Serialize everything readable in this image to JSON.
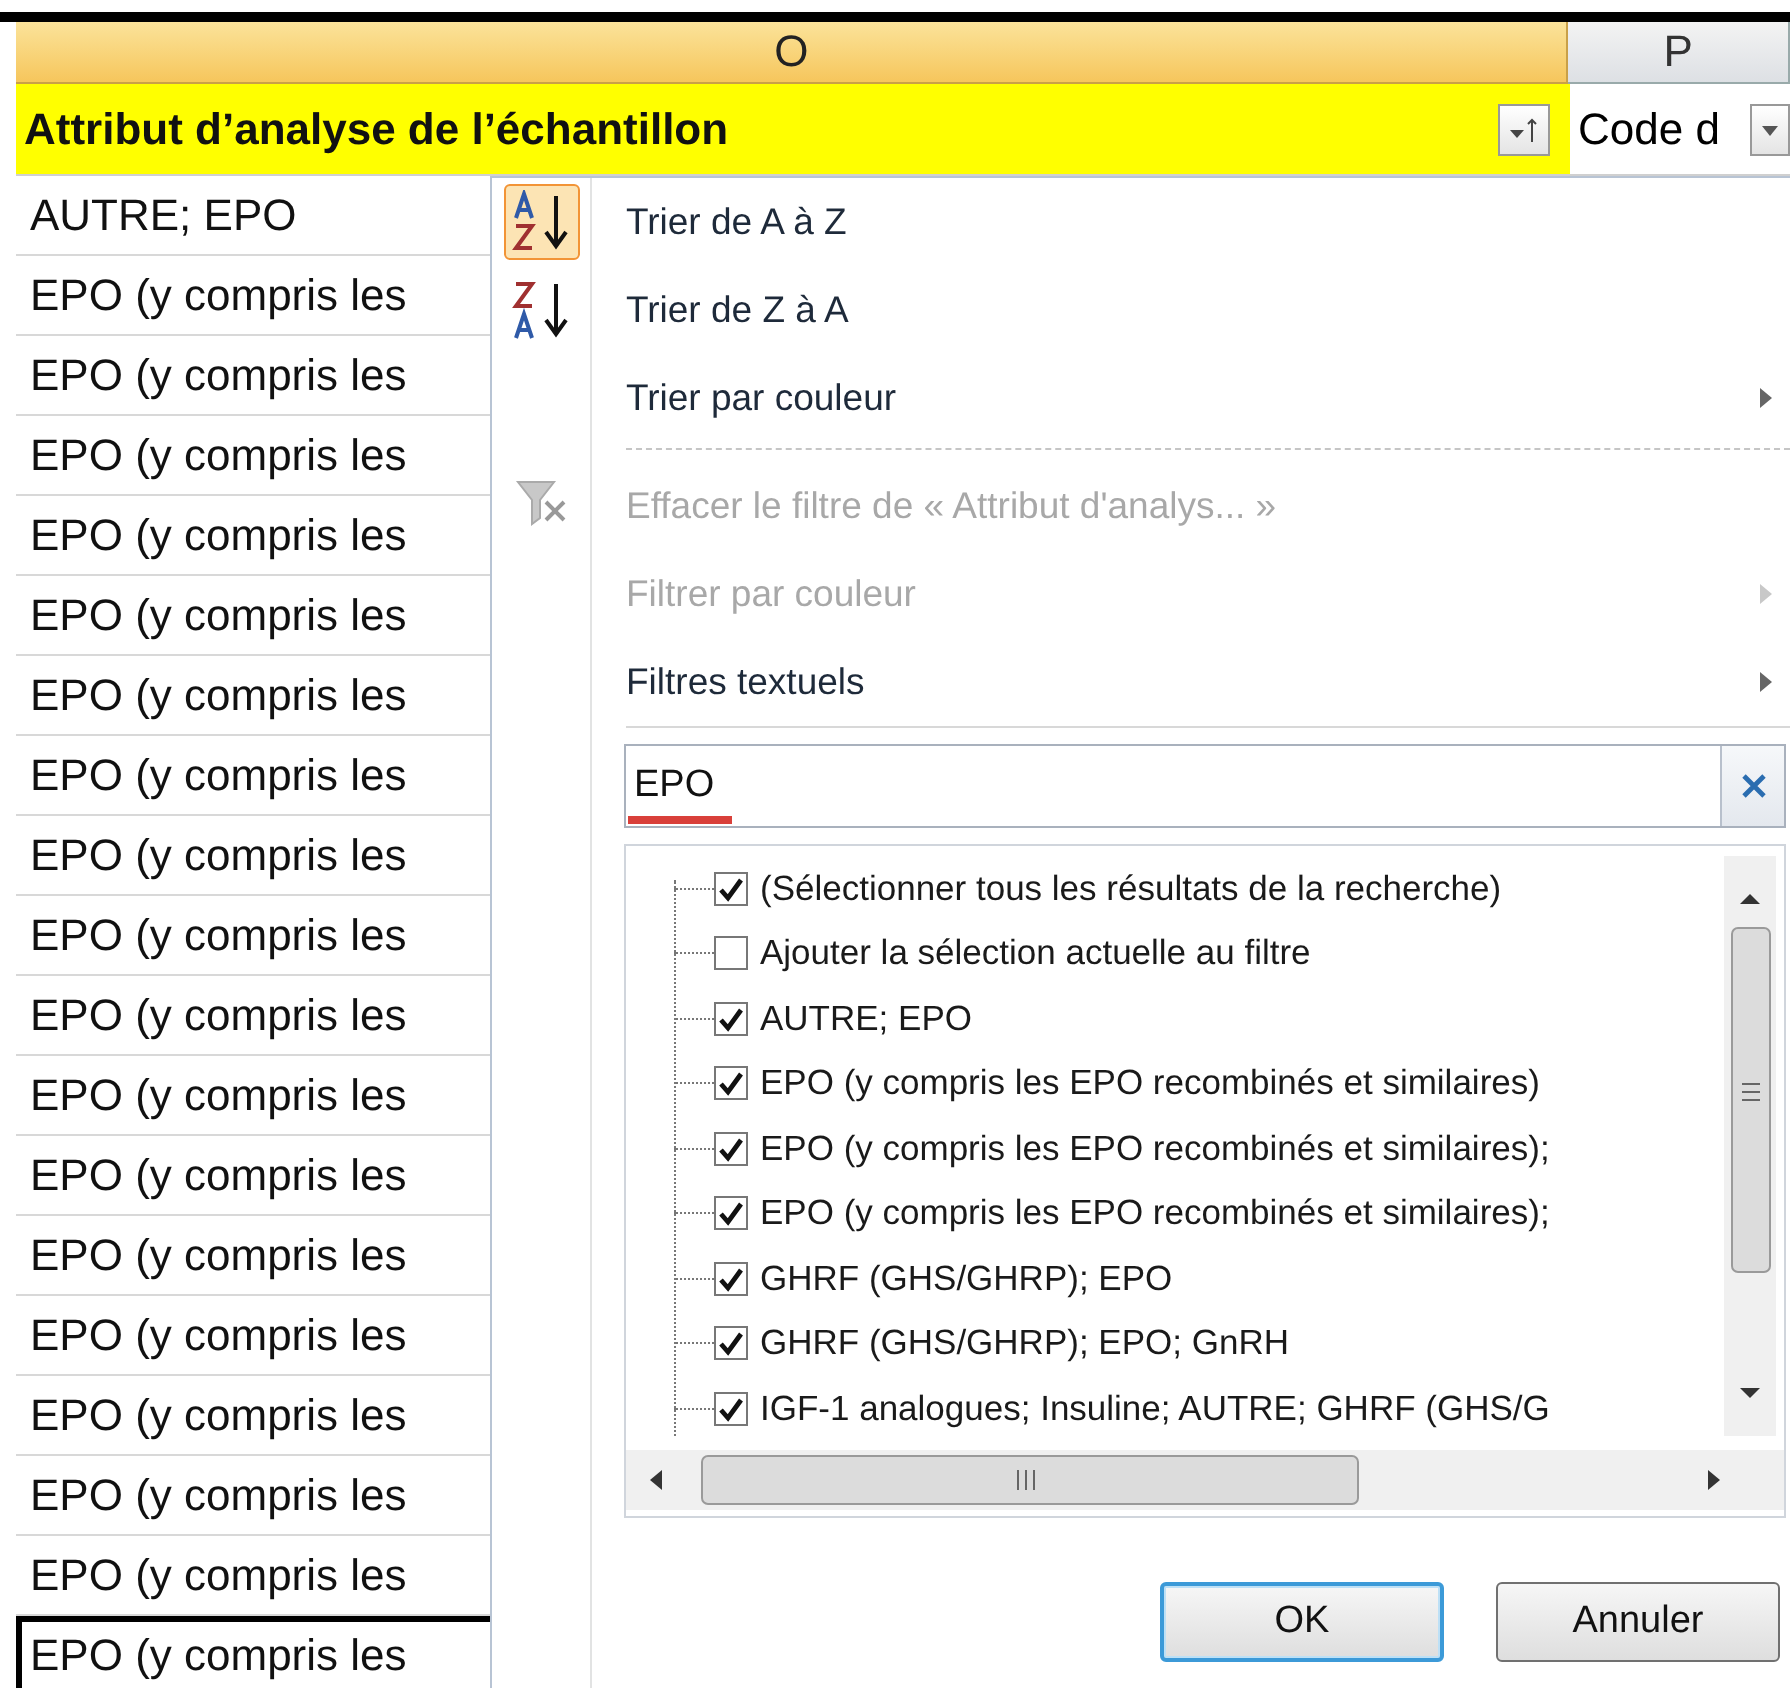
{
  "sheet": {
    "columns": [
      {
        "label": "O",
        "selected": true
      },
      {
        "label": "P",
        "selected": false
      }
    ],
    "header": {
      "title": "Attribut d’analyse de l’échantillon",
      "filter_active": true,
      "next": "Code d"
    },
    "rows": [
      {
        "text": "AUTRE; EPO",
        "selected": false
      },
      {
        "text": "EPO (y compris les",
        "selected": false
      },
      {
        "text": "EPO (y compris les",
        "selected": false
      },
      {
        "text": "EPO (y compris les",
        "selected": false
      },
      {
        "text": "EPO (y compris les",
        "selected": false
      },
      {
        "text": "EPO (y compris les",
        "selected": false
      },
      {
        "text": "EPO (y compris les",
        "selected": false
      },
      {
        "text": "EPO (y compris les",
        "selected": false
      },
      {
        "text": "EPO (y compris les",
        "selected": false
      },
      {
        "text": "EPO (y compris les",
        "selected": false
      },
      {
        "text": "EPO (y compris les",
        "selected": false
      },
      {
        "text": "EPO (y compris les",
        "selected": false
      },
      {
        "text": "EPO (y compris les",
        "selected": false
      },
      {
        "text": "EPO (y compris les",
        "selected": false
      },
      {
        "text": "EPO (y compris les",
        "selected": false
      },
      {
        "text": "EPO (y compris les",
        "selected": false
      },
      {
        "text": "EPO (y compris les",
        "selected": false
      },
      {
        "text": "EPO (y compris les",
        "selected": false
      },
      {
        "text": "EPO (y compris les",
        "selected": true
      }
    ]
  },
  "menu": {
    "items": [
      {
        "kind": "sort-ascending",
        "label": "Trier de A à Z",
        "disabled": false,
        "submenu": false,
        "selected": true
      },
      {
        "kind": "sort-descending",
        "label": "Trier de Z à A",
        "disabled": false,
        "submenu": false,
        "selected": false
      },
      {
        "kind": "plain",
        "label": "Trier par couleur",
        "disabled": false,
        "submenu": true,
        "selected": false
      },
      {
        "kind": "separator"
      },
      {
        "kind": "clear-filter",
        "label": "Effacer le filtre de « Attribut d'analys... »",
        "disabled": true,
        "submenu": false,
        "selected": false
      },
      {
        "kind": "plain",
        "label": "Filtrer par couleur",
        "disabled": true,
        "submenu": true,
        "selected": false
      },
      {
        "kind": "plain",
        "label": "Filtres textuels",
        "disabled": false,
        "submenu": true,
        "selected": false
      },
      {
        "kind": "separator"
      }
    ],
    "search": {
      "value": "EPO"
    },
    "values": [
      {
        "label": "(Sélectionner tous les résultats de la recherche)",
        "checked": true
      },
      {
        "label": "Ajouter la sélection actuelle au filtre",
        "checked": false
      },
      {
        "label": "AUTRE; EPO",
        "checked": true
      },
      {
        "label": "EPO (y compris les EPO recombinés et similaires)",
        "checked": true
      },
      {
        "label": "EPO (y compris les EPO recombinés et similaires);",
        "checked": true
      },
      {
        "label": "EPO (y compris les EPO recombinés et similaires);",
        "checked": true
      },
      {
        "label": "GHRF (GHS/GHRP); EPO",
        "checked": true
      },
      {
        "label": "GHRF (GHS/GHRP); EPO; GnRH",
        "checked": true
      },
      {
        "label": "IGF-1 analogues; Insuline; AUTRE; GHRF (GHS/G",
        "checked": true
      }
    ],
    "buttons": [
      {
        "label": "OK",
        "default": true
      },
      {
        "label": "Annuler",
        "default": false
      }
    ]
  }
}
